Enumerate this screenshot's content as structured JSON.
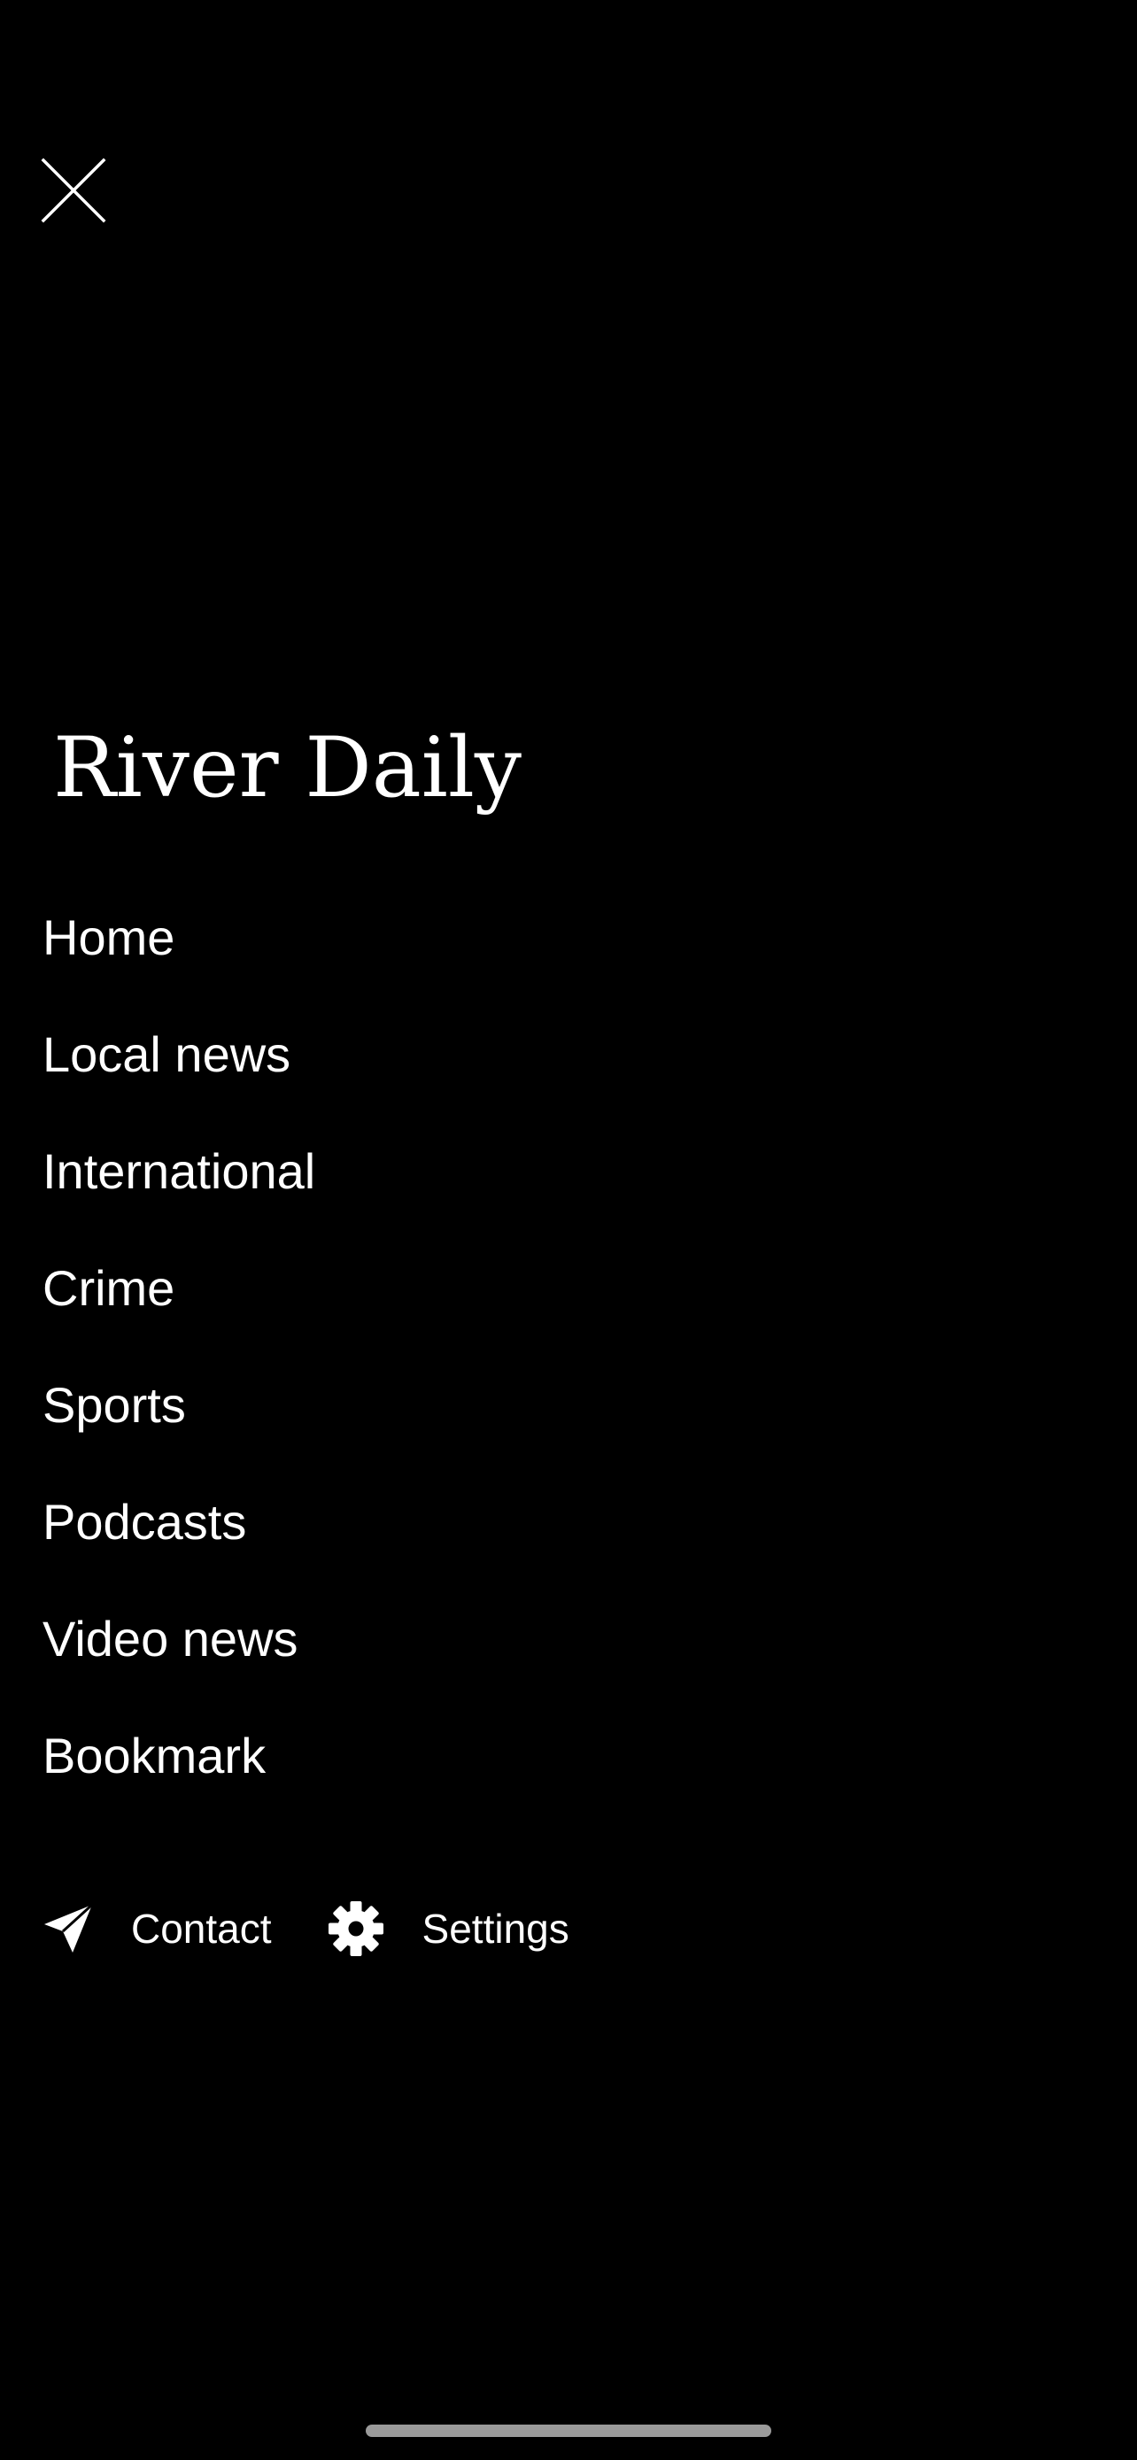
{
  "header": {
    "close_icon": "close-icon"
  },
  "brand": {
    "title": "River Daily"
  },
  "menu": {
    "items": [
      {
        "label": "Home"
      },
      {
        "label": "Local news"
      },
      {
        "label": "International"
      },
      {
        "label": "Crime"
      },
      {
        "label": "Sports"
      },
      {
        "label": "Podcasts"
      },
      {
        "label": "Video news"
      },
      {
        "label": "Bookmark"
      }
    ]
  },
  "footer": {
    "contact": {
      "label": "Contact",
      "icon": "paper-plane-icon"
    },
    "settings": {
      "label": "Settings",
      "icon": "gear-icon"
    }
  },
  "colors": {
    "background": "#000000",
    "text": "#ffffff",
    "home_indicator": "#9a9a9a"
  }
}
